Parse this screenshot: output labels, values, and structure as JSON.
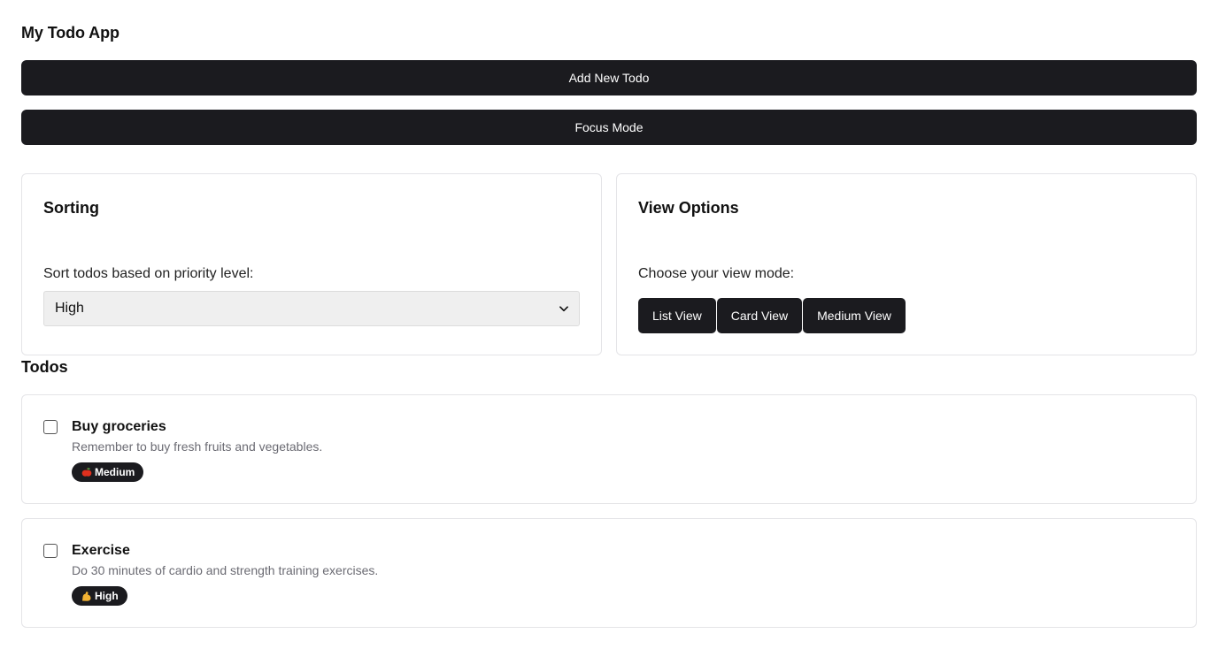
{
  "app": {
    "title": "My Todo App"
  },
  "actions": {
    "add_label": "Add New Todo",
    "focus_label": "Focus Mode"
  },
  "sorting": {
    "title": "Sorting",
    "label": "Sort todos based on priority level:",
    "selected": "High",
    "chevron_icon": "chevron-down-icon"
  },
  "view_options": {
    "title": "View Options",
    "label": "Choose your view mode:",
    "buttons": [
      "List View",
      "Card View",
      "Medium View"
    ]
  },
  "todos_section": {
    "title": "Todos",
    "items": [
      {
        "title": "Buy groceries",
        "description": "Remember to buy fresh fruits and vegetables.",
        "priority": "Medium",
        "priority_icon": "apple-icon",
        "priority_color": "#e0301e",
        "checked": false
      },
      {
        "title": "Exercise",
        "description": "Do 30 minutes of cardio and strength training exercises.",
        "priority": "High",
        "priority_icon": "flexed-arm-icon",
        "priority_color": "#f2b233",
        "checked": false
      }
    ]
  },
  "colors": {
    "primary": "#1b1b1f",
    "border": "#e4e4e7",
    "muted_text": "#6b6b73",
    "select_bg": "#efefef"
  }
}
